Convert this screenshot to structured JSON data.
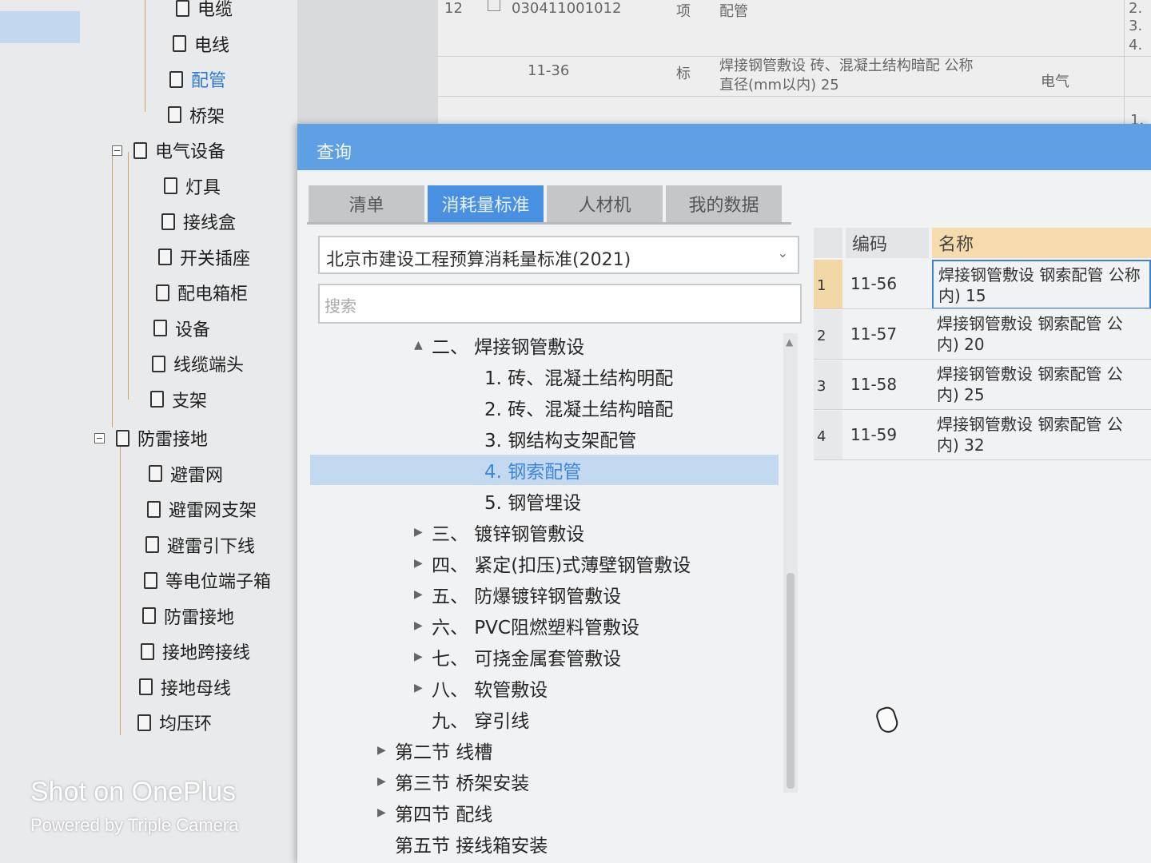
{
  "left_tree": [
    {
      "label": "电缆",
      "type": "doc"
    },
    {
      "label": "电线",
      "type": "doc"
    },
    {
      "label": "配管",
      "type": "doc",
      "active": true
    },
    {
      "label": "桥架",
      "type": "doc"
    },
    {
      "label": "电气设备",
      "type": "folder"
    },
    {
      "label": "灯具",
      "type": "doc"
    },
    {
      "label": "接线盒",
      "type": "doc"
    },
    {
      "label": "开关插座",
      "type": "doc"
    },
    {
      "label": "配电箱柜",
      "type": "doc"
    },
    {
      "label": "设备",
      "type": "doc"
    },
    {
      "label": "线缆端头",
      "type": "doc"
    },
    {
      "label": "支架",
      "type": "doc"
    },
    {
      "label": "防雷接地",
      "type": "folder"
    },
    {
      "label": "避雷网",
      "type": "doc"
    },
    {
      "label": "避雷网支架",
      "type": "doc"
    },
    {
      "label": "避雷引下线",
      "type": "doc"
    },
    {
      "label": "等电位端子箱",
      "type": "doc"
    },
    {
      "label": "防雷接地",
      "type": "doc"
    },
    {
      "label": "接地跨接线",
      "type": "doc"
    },
    {
      "label": "接地母线",
      "type": "doc"
    },
    {
      "label": "均压环",
      "type": "doc"
    }
  ],
  "bg_list": {
    "row12": {
      "num": "12",
      "code": "030411001012",
      "type": "项",
      "name": "配管"
    },
    "row_sub": {
      "code": "11-36",
      "type": "标",
      "name_line1": "焊接钢管敷设 砖、混凝土结构暗配 公称",
      "name_line2": "直径(mm以内) 25",
      "unit": "电气"
    },
    "right_col": [
      "2.",
      "3.",
      "4.",
      "1."
    ]
  },
  "dialog": {
    "title": "查询",
    "tabs": [
      {
        "label": "清单",
        "active": false
      },
      {
        "label": "消耗量标准",
        "active": true
      },
      {
        "label": "人材机",
        "active": false
      },
      {
        "label": "我的数据",
        "active": false
      }
    ],
    "standard_select": "北京市建设工程预算消耗量标准(2021)",
    "search_placeholder": "搜索",
    "chapter_tree": [
      {
        "label": "二、 焊接钢管敷设",
        "arrow": "▲",
        "indent": 1
      },
      {
        "label": "1. 砖、混凝土结构明配",
        "arrow": "",
        "indent": 2
      },
      {
        "label": "2. 砖、混凝土结构暗配",
        "arrow": "",
        "indent": 2
      },
      {
        "label": "3. 钢结构支架配管",
        "arrow": "",
        "indent": 2
      },
      {
        "label": "4. 钢索配管",
        "arrow": "",
        "indent": 2,
        "selected": true
      },
      {
        "label": "5. 钢管埋设",
        "arrow": "",
        "indent": 2
      },
      {
        "label": "三、 镀锌钢管敷设",
        "arrow": "▶",
        "indent": 1
      },
      {
        "label": "四、 紧定(扣压)式薄壁钢管敷设",
        "arrow": "▶",
        "indent": 1
      },
      {
        "label": "五、 防爆镀锌钢管敷设",
        "arrow": "▶",
        "indent": 1
      },
      {
        "label": "六、 PVC阻燃塑料管敷设",
        "arrow": "▶",
        "indent": 1
      },
      {
        "label": "七、 可挠金属套管敷设",
        "arrow": "▶",
        "indent": 1
      },
      {
        "label": "八、 软管敷设",
        "arrow": "▶",
        "indent": 1
      },
      {
        "label": "九、 穿引线",
        "arrow": "",
        "indent": 1
      },
      {
        "label": "第二节 线槽",
        "arrow": "▶",
        "indent": 0
      },
      {
        "label": "第三节 桥架安装",
        "arrow": "▶",
        "indent": 0
      },
      {
        "label": "第四节 配线",
        "arrow": "▶",
        "indent": 0
      },
      {
        "label": "第五节 接线箱安装",
        "arrow": "",
        "indent": 0
      }
    ],
    "table": {
      "headers": {
        "code": "编码",
        "name": "名称"
      },
      "rows": [
        {
          "idx": "1",
          "code": "11-56",
          "name_line1": "焊接钢管敷设 钢索配管 公称",
          "name_line2": "内) 15"
        },
        {
          "idx": "2",
          "code": "11-57",
          "name_line1": "焊接钢管敷设 钢索配管 公",
          "name_line2": "内) 20"
        },
        {
          "idx": "3",
          "code": "11-58",
          "name_line1": "焊接钢管敷设 钢索配管 公",
          "name_line2": "内) 25"
        },
        {
          "idx": "4",
          "code": "11-59",
          "name_line1": "焊接钢管敷设 钢索配管 公",
          "name_line2": "内) 32"
        }
      ]
    }
  },
  "watermark": {
    "line1": "Shot on OnePlus",
    "line2": "Powered by Triple Camera"
  },
  "colors": {
    "accent": "#4a90e2",
    "title_bar": "#5f9fe3",
    "selected_row": "#c3d9f0",
    "tree_line": "#cfa260",
    "header_highlight": "#f6dcad"
  }
}
